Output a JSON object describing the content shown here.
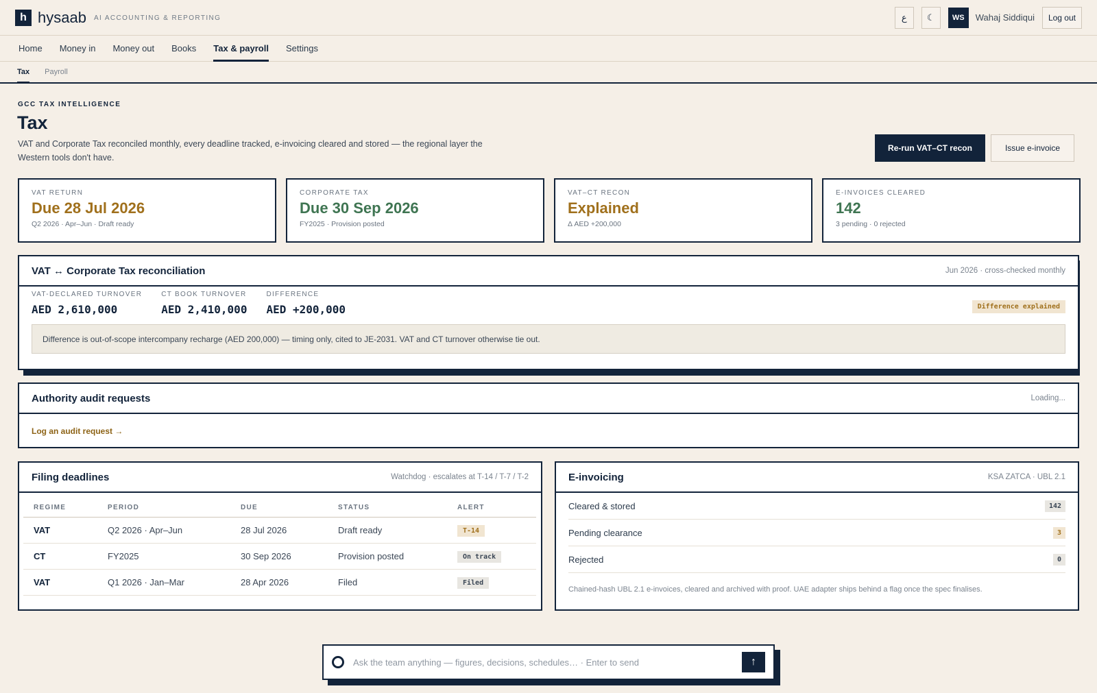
{
  "brand": {
    "logo_letter": "h",
    "name": "hysaab",
    "tagline": "AI ACCOUNTING & REPORTING"
  },
  "topbar": {
    "lang_label": "ع",
    "theme_label": "☾",
    "avatar_initials": "WS",
    "user_name": "Wahaj Siddiqui",
    "logout_label": "Log out"
  },
  "nav": {
    "items": [
      "Home",
      "Money in",
      "Money out",
      "Books",
      "Tax & payroll",
      "Settings"
    ],
    "active": "Tax & payroll"
  },
  "subnav": {
    "items": [
      "Tax",
      "Payroll"
    ],
    "active": "Tax"
  },
  "header": {
    "eyebrow": "GCC TAX INTELLIGENCE",
    "title": "Tax",
    "description": "VAT and Corporate Tax reconciled monthly, every deadline tracked, e-invoicing cleared and stored — the regional layer the Western tools don't have.",
    "primary_action": "Re-run VAT–CT recon",
    "secondary_action": "Issue e-invoice"
  },
  "kpis": [
    {
      "label": "VAT RETURN",
      "value": "Due 28 Jul 2026",
      "sub": "Q2 2026 · Apr–Jun · Draft ready",
      "tone": "gold"
    },
    {
      "label": "CORPORATE TAX",
      "value": "Due 30 Sep 2026",
      "sub": "FY2025 · Provision posted",
      "tone": "green"
    },
    {
      "label": "VAT–CT RECON",
      "value": "Explained",
      "sub": "Δ AED +200,000",
      "tone": "gold"
    },
    {
      "label": "E-INVOICES CLEARED",
      "value": "142",
      "sub": "3 pending · 0 rejected",
      "tone": "green"
    }
  ],
  "recon": {
    "title": "VAT ↔ Corporate Tax reconciliation",
    "meta": "Jun 2026 · cross-checked monthly",
    "figures": [
      {
        "label": "VAT-DECLARED TURNOVER",
        "value": "AED 2,610,000"
      },
      {
        "label": "CT BOOK TURNOVER",
        "value": "AED 2,410,000"
      },
      {
        "label": "DIFFERENCE",
        "value": "AED +200,000"
      }
    ],
    "badge": "Difference explained",
    "note": "Difference is out-of-scope intercompany recharge (AED 200,000) — timing only, cited to JE-2031. VAT and CT turnover otherwise tie out."
  },
  "audit": {
    "title": "Authority audit requests",
    "meta": "Loading...",
    "link": "Log an audit request →"
  },
  "deadlines": {
    "title": "Filing deadlines",
    "meta": "Watchdog · escalates at T-14 / T-7 / T-2",
    "columns": [
      "REGIME",
      "PERIOD",
      "DUE",
      "STATUS",
      "ALERT"
    ],
    "rows": [
      {
        "regime": "VAT",
        "period": "Q2 2026 · Apr–Jun",
        "due": "28 Jul 2026",
        "status": "Draft ready",
        "alert": "T-14",
        "alert_tone": "gold"
      },
      {
        "regime": "CT",
        "period": "FY2025",
        "due": "30 Sep 2026",
        "status": "Provision posted",
        "alert": "On track",
        "alert_tone": "grey"
      },
      {
        "regime": "VAT",
        "period": "Q1 2026 · Jan–Mar",
        "due": "28 Apr 2026",
        "status": "Filed",
        "alert": "Filed",
        "alert_tone": "grey"
      }
    ]
  },
  "einvoicing": {
    "title": "E-invoicing",
    "meta": "KSA ZATCA · UBL 2.1",
    "rows": [
      {
        "label": "Cleared & stored",
        "count": "142",
        "tone": "grey"
      },
      {
        "label": "Pending clearance",
        "count": "3",
        "tone": "gold"
      },
      {
        "label": "Rejected",
        "count": "0",
        "tone": "grey"
      }
    ],
    "note": "Chained-hash UBL 2.1 e-invoices, cleared and archived with proof. UAE adapter ships behind a flag once the spec finalises."
  },
  "chat": {
    "placeholder": "Ask the team anything — figures, decisions, schedules…  · Enter to send",
    "send_label": "↑"
  },
  "colors": {
    "navy": "#12233a",
    "gold": "#a0701c",
    "green": "#3f7552",
    "background": "#f5efe7"
  }
}
